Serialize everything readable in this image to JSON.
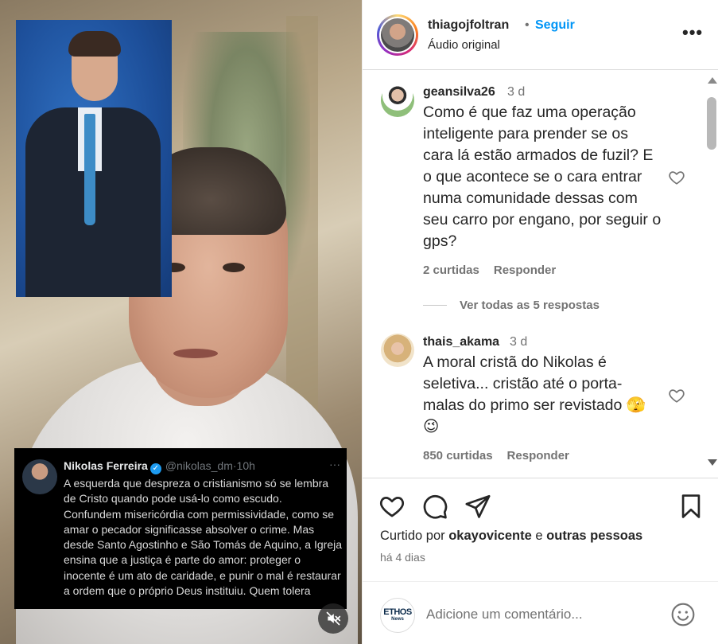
{
  "video": {
    "tweet": {
      "author_name": "Nikolas Ferreira",
      "handle": "@nikolas_dm",
      "time": "10h",
      "separator": "·",
      "more": "···",
      "verified_glyph": "✓",
      "text": "A esquerda que despreza o cristianismo só se lembra de Cristo quando pode usá-lo como escudo. Confundem misericórdia com permissividade, como se amar o pecador significasse absolver o crime. Mas desde Santo Agostinho e São Tomás de Aquino, a Igreja ensina que a justiça é parte do amor: proteger o inocente é um ato de caridade, e punir o mal é restaurar a ordem que o próprio Deus instituiu. Quem tolera"
    },
    "mute_icon": "muted-speaker-icon"
  },
  "post_header": {
    "username": "thiagojfoltran",
    "dot": "•",
    "follow_label": "Seguir",
    "audio_label": "Áudio original",
    "more_label": "•••"
  },
  "comments": [
    {
      "username": "geansilva26",
      "time": "3 d",
      "text": "Como é que faz uma operação inteligente para prender se os cara lá estão armados de fuzil? E o que acontece se o cara entrar numa comunidade dessas com seu carro por engano, por seguir o gps?",
      "likes": "2 curtidas",
      "reply_label": "Responder",
      "view_replies": "Ver todas as 5 respostas"
    },
    {
      "username": "thais_akama",
      "time": "3 d",
      "text": "A moral cristã do Nikolas é seletiva... cristão até o porta-malas do primo ser revistado 🫣 😉",
      "likes": "850 curtidas",
      "reply_label": "Responder"
    }
  ],
  "actions": {
    "icons": [
      "heart-icon",
      "comment-icon",
      "share-icon",
      "bookmark-icon"
    ],
    "liked_by_prefix": "Curtido por",
    "liked_by_user": "okayovicente",
    "liked_by_and": "e",
    "liked_by_others": "outras pessoas",
    "age": "há 4 dias"
  },
  "add_comment": {
    "logo_text": "ETHOS",
    "logo_sub": "News",
    "placeholder": "Adicione um comentário..."
  },
  "colors": {
    "accent": "#0095f6",
    "text": "#262626",
    "muted": "#737373"
  }
}
